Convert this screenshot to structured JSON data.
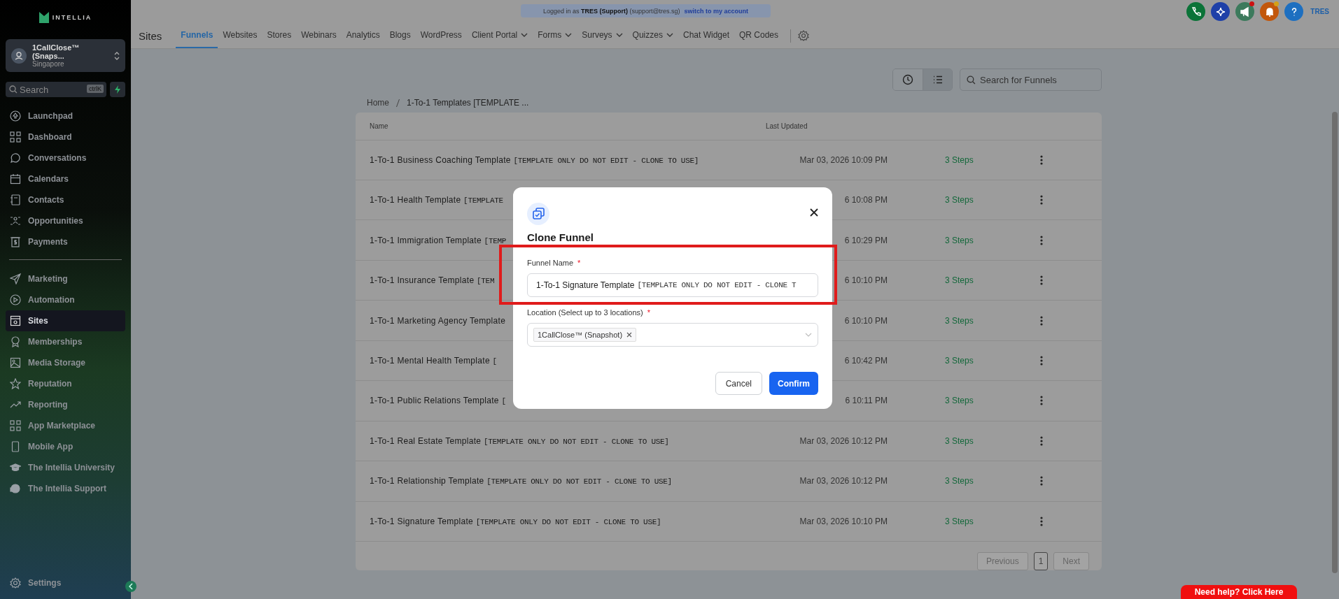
{
  "sidebar": {
    "logo": "INTELLIA",
    "account": {
      "name": "1CallClose™ (Snaps...",
      "location": "Singapore"
    },
    "search": {
      "placeholder": "Search",
      "shortcut": "ctrlK"
    },
    "groups": [
      [
        {
          "label": "Launchpad",
          "selected": false
        },
        {
          "label": "Dashboard",
          "selected": false
        },
        {
          "label": "Conversations",
          "selected": false
        },
        {
          "label": "Calendars",
          "selected": false
        },
        {
          "label": "Contacts",
          "selected": false
        },
        {
          "label": "Opportunities",
          "selected": false
        },
        {
          "label": "Payments",
          "selected": false
        }
      ],
      [
        {
          "label": "Marketing",
          "selected": false
        },
        {
          "label": "Automation",
          "selected": false
        },
        {
          "label": "Sites",
          "selected": true
        },
        {
          "label": "Memberships",
          "selected": false
        },
        {
          "label": "Media Storage",
          "selected": false
        },
        {
          "label": "Reputation",
          "selected": false
        },
        {
          "label": "Reporting",
          "selected": false
        },
        {
          "label": "App Marketplace",
          "selected": false
        },
        {
          "label": "Mobile App",
          "selected": false
        },
        {
          "label": "The Intellia University",
          "selected": false
        },
        {
          "label": "The Intellia Support",
          "selected": false
        }
      ]
    ],
    "settings": "Settings"
  },
  "topbar": {
    "banner": {
      "prefix": "Logged in as",
      "user": "TRES (Support)",
      "email": "(support@tres.sg)",
      "link": "switch to my account"
    },
    "title": "Sites",
    "tabs": [
      {
        "label": "Funnels",
        "selected": true,
        "dropdown": false
      },
      {
        "label": "Websites",
        "selected": false,
        "dropdown": false
      },
      {
        "label": "Stores",
        "selected": false,
        "dropdown": false
      },
      {
        "label": "Webinars",
        "selected": false,
        "dropdown": false
      },
      {
        "label": "Analytics",
        "selected": false,
        "dropdown": false
      },
      {
        "label": "Blogs",
        "selected": false,
        "dropdown": false
      },
      {
        "label": "WordPress",
        "selected": false,
        "dropdown": false
      },
      {
        "label": "Client Portal",
        "selected": false,
        "dropdown": true
      },
      {
        "label": "Forms",
        "selected": false,
        "dropdown": true
      },
      {
        "label": "Surveys",
        "selected": false,
        "dropdown": true
      },
      {
        "label": "Quizzes",
        "selected": false,
        "dropdown": true
      },
      {
        "label": "Chat Widget",
        "selected": false,
        "dropdown": false
      },
      {
        "label": "QR Codes",
        "selected": false,
        "dropdown": false
      }
    ],
    "actions": [
      {
        "kind": "phone",
        "color": "#0b7338"
      },
      {
        "kind": "sparkle",
        "color": "#1e40a8"
      },
      {
        "kind": "megaphone",
        "color": "#3c7a5c",
        "badge": {
          "color": "#cc1111"
        }
      },
      {
        "kind": "bell",
        "color": "#c2570c",
        "badge": {
          "color": "#d4a017"
        }
      },
      {
        "kind": "help",
        "color": "#1d6fc0"
      }
    ],
    "user": "TRES"
  },
  "toolbar": {
    "views": [
      {
        "kind": "clock",
        "selected": false
      },
      {
        "kind": "list",
        "selected": true
      }
    ],
    "search_placeholder": "Search for Funnels"
  },
  "breadcrumb": [
    "Home",
    "1-To-1 Templates [TEMPLATE ..."
  ],
  "table": {
    "columns": [
      "Name",
      "Last Updated"
    ],
    "rows": [
      {
        "name": "1-To-1 Business Coaching Template",
        "tag": "[TEMPLATE ONLY DO NOT EDIT - CLONE TO USE]",
        "updated": "Mar 03, 2026 10:09 PM",
        "steps": "3 Steps"
      },
      {
        "name": "1-To-1 Health Template",
        "tag": "[TEMPLATE",
        "updated": "6 10:08 PM",
        "steps": "3 Steps"
      },
      {
        "name": "1-To-1 Immigration Template",
        "tag": "[TEMP",
        "updated": "6 10:29 PM",
        "steps": "3 Steps"
      },
      {
        "name": "1-To-1 Insurance Template",
        "tag": "[TEM",
        "updated": "6 10:10 PM",
        "steps": "3 Steps"
      },
      {
        "name": "1-To-1 Marketing Agency Template",
        "tag": "",
        "updated": "6 10:10 PM",
        "steps": "3 Steps"
      },
      {
        "name": "1-To-1 Mental Health Template",
        "tag": "[",
        "updated": "6 10:42 PM",
        "steps": "3 Steps"
      },
      {
        "name": "1-To-1 Public Relations Template",
        "tag": "[",
        "updated": "6 10:11 PM",
        "steps": "3 Steps"
      },
      {
        "name": "1-To-1 Real Estate Template",
        "tag": "[TEMPLATE ONLY DO NOT EDIT - CLONE TO USE]",
        "updated": "Mar 03, 2026 10:12 PM",
        "steps": "3 Steps"
      },
      {
        "name": "1-To-1 Relationship Template",
        "tag": "[TEMPLATE ONLY DO NOT EDIT - CLONE TO USE]",
        "updated": "Mar 03, 2026 10:12 PM",
        "steps": "3 Steps"
      },
      {
        "name": "1-To-1 Signature Template",
        "tag": "[TEMPLATE ONLY DO NOT EDIT - CLONE TO USE]",
        "updated": "Mar 03, 2026 10:10 PM",
        "steps": "3 Steps"
      }
    ]
  },
  "pagination": {
    "previous": "Previous",
    "pages": [
      {
        "label": "1",
        "selected": true
      }
    ],
    "next": "Next"
  },
  "modal": {
    "title": "Clone Funnel",
    "fields": [
      {
        "kind": "text",
        "label": "Funnel Name",
        "required_mark": "*",
        "value": "1-To-1 Signature Template",
        "value_tag": "[TEMPLATE ONLY DO NOT EDIT - CLONE T",
        "highlighted": true
      },
      {
        "kind": "select",
        "label": "Location (Select up to 3 locations)",
        "required_mark": "*",
        "tags": [
          "1CallClose™ (Snapshot)"
        ],
        "highlighted": false
      }
    ],
    "cancel": "Cancel",
    "confirm": "Confirm"
  },
  "help_button": "Need help? Click Here"
}
